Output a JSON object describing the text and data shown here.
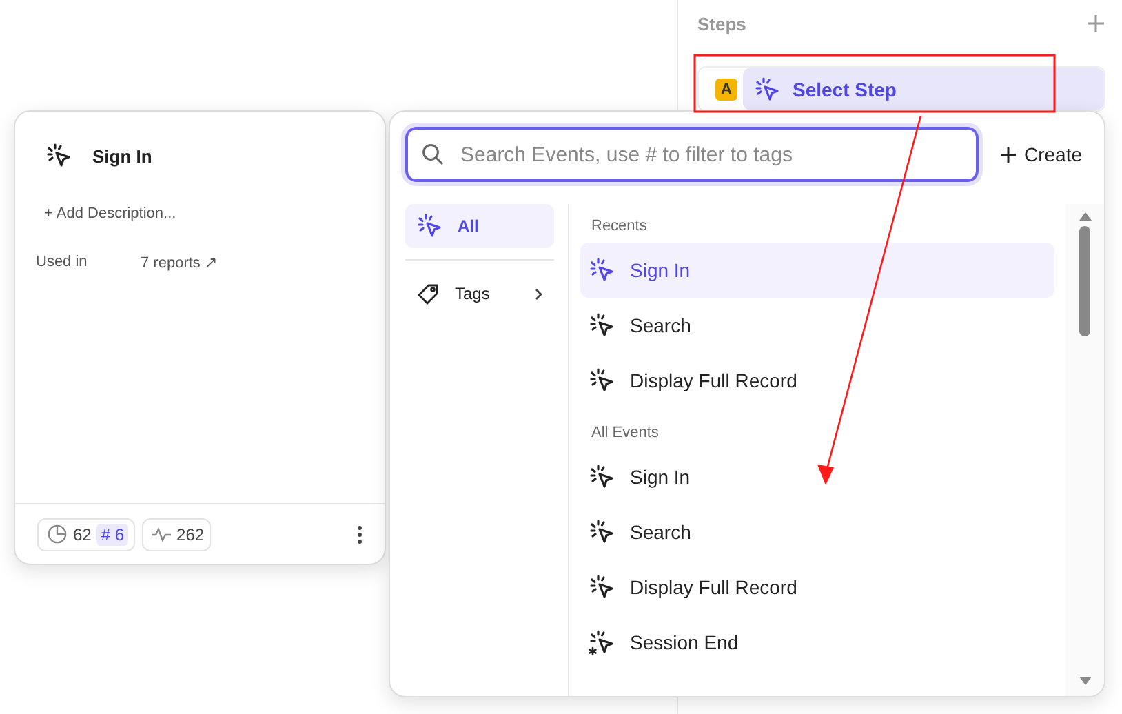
{
  "steps_panel": {
    "title": "Steps",
    "step": {
      "badge": "A",
      "label": "Select Step",
      "selected": true
    }
  },
  "event_card": {
    "title": "Sign In",
    "description_link": "+ Add Description...",
    "used_in_label": "Used in",
    "used_in_value": "7 reports ↗",
    "stats": {
      "reports": "62",
      "tags": "# 6",
      "volume": "262"
    }
  },
  "event_picker": {
    "search": {
      "placeholder": "Search Events, use # to filter to tags"
    },
    "create_label": "Create",
    "nav": [
      {
        "label": "All",
        "selected": true,
        "kind": "events"
      },
      {
        "label": "Tags",
        "selected": false,
        "kind": "tags"
      }
    ],
    "sections": [
      {
        "title": "Recents",
        "items": [
          {
            "label": "Sign In",
            "selected": true,
            "kind": "event"
          },
          {
            "label": "Search",
            "selected": false,
            "kind": "event"
          },
          {
            "label": "Display Full Record",
            "selected": false,
            "kind": "event"
          }
        ]
      },
      {
        "title": "All Events",
        "items": [
          {
            "label": "Sign In",
            "selected": false,
            "kind": "event"
          },
          {
            "label": "Search",
            "selected": false,
            "kind": "event"
          },
          {
            "label": "Display Full Record",
            "selected": false,
            "kind": "event"
          },
          {
            "label": "Session End",
            "selected": false,
            "kind": "session"
          }
        ]
      }
    ]
  }
}
